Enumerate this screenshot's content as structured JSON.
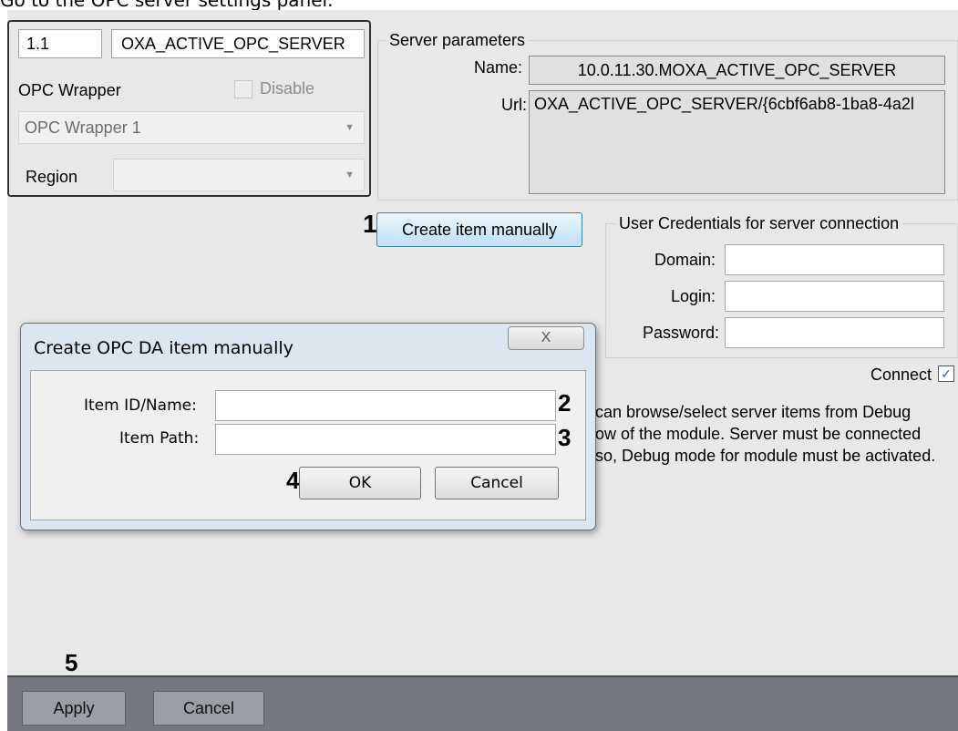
{
  "caption": "Go to the OPC server settings panel.",
  "object": {
    "id": "1.1",
    "name": "OXA_ACTIVE_OPC_SERVER",
    "type_label": "OPC Wrapper",
    "disable_label": "Disable",
    "parent_value": "OPC Wrapper 1",
    "region_label": "Region",
    "region_value": ""
  },
  "server": {
    "group_title": "Server parameters",
    "name_label": "Name:",
    "name_value": "10.0.11.30.MOXA_ACTIVE_OPC_SERVER",
    "url_label": "Url:",
    "url_value": "OXA_ACTIVE_OPC_SERVER/{6cbf6ab8-1ba8-4a2l"
  },
  "create_button": "Create item manually",
  "credentials": {
    "group_title": "User Credentials for server connection",
    "domain_label": "Domain:",
    "login_label": "Login:",
    "password_label": "Password:"
  },
  "connect_label": "Connect",
  "note_lines": [
    "can browse/select server items from Debug",
    "ow of the module. Server must be connected",
    "so, Debug mode for module must be activated."
  ],
  "dialog": {
    "title": "Create OPC DA item manually",
    "close_glyph": "X",
    "item_id_label": "Item ID/Name:",
    "item_path_label": "Item Path:",
    "ok_label": "OK",
    "cancel_label": "Cancel"
  },
  "step_numbers": {
    "s1": "1",
    "s2": "2",
    "s3": "3",
    "s4": "4",
    "s5": "5"
  },
  "bottom": {
    "apply_label": "Apply",
    "cancel_label": "Cancel"
  },
  "colors": {
    "panel": "#e8e8e8",
    "bottom_bar": "#74777e",
    "dialog_frame": "#dbe6f1",
    "create_button": "#bfe0f4"
  }
}
